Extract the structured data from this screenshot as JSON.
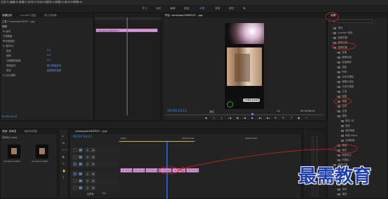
{
  "menu": [
    "文件(F)",
    "编辑(E)",
    "剪辑(C)",
    "序列(S)",
    "标记(M)",
    "图形(G)",
    "视图(V)",
    "窗口(W)",
    "帮助(H)"
  ],
  "workspaces": [
    {
      "label": "学习",
      "active": false
    },
    {
      "label": "组件",
      "active": false
    },
    {
      "label": "编辑",
      "active": false
    },
    {
      "label": "颜色",
      "active": false
    },
    {
      "label": "效果",
      "active": true
    },
    {
      "label": "音频",
      "active": false
    },
    {
      "label": "图形",
      "active": false
    },
    {
      "label": "库",
      "active": false
    }
  ],
  "effect_controls": {
    "tabs": [
      "效果控件",
      "Lumetri 范围",
      "源:(无剪辑)",
      "音频剪辑混合器:"
    ],
    "master_label": "主要 * mmexport1609....jpg",
    "sequence_label": "序列 * mmexport1609....jpg",
    "clip_label": "mmexport1609537...",
    "video_heading": "视频",
    "rows": [
      {
        "label": "fx 运动",
        "value": "",
        "indent": 0
      },
      {
        "label": "不透明度",
        "value": "",
        "indent": 0
      },
      {
        "label": "时间重映射",
        "value": "",
        "indent": 0
      },
      {
        "label": "fx 基本3D",
        "value": "",
        "indent": 0
      },
      {
        "label": "旋转",
        "value": "0.0",
        "indent": 1
      },
      {
        "label": "倾斜",
        "value": "0.0",
        "indent": 1
      },
      {
        "label": "与图像的距离",
        "value": "0.0",
        "indent": 1
      },
      {
        "label": "镜面高光",
        "value": "显示镜面高光",
        "indent": 1
      },
      {
        "label": "预览",
        "value": "绘制预览线框",
        "indent": 1
      },
      {
        "label": "fx 交叉溶解",
        "value": "",
        "indent": 0
      }
    ],
    "timecode": "00:00:03:11"
  },
  "program": {
    "title": "节目: mmexport1609537....jpg",
    "timecode": "00:00:03:11",
    "fit": "适合",
    "ratio": "1/2",
    "duration": "00:00:06:00",
    "caption_text": "分享教程 更多资源"
  },
  "project": {
    "tabs": [
      "项目: 未命名",
      "媒体浏览器"
    ],
    "project_name": "未命名.prproj",
    "items": [
      {
        "name": "mmexport1609...",
        "duration": "5:00"
      },
      {
        "name": "mmexport1609...",
        "duration": "5:00"
      }
    ]
  },
  "timeline": {
    "tab": "mmexport1609537....jpg",
    "timecode": "00:00:03:11",
    "ruler_marks": [
      "00:00",
      "00:00:05:00",
      "00:00:10:00",
      "00:00:15:00"
    ],
    "tracks": [
      {
        "id": "V3"
      },
      {
        "id": "V2"
      },
      {
        "id": "V1"
      },
      {
        "id": "A1"
      },
      {
        "id": "A2"
      },
      {
        "id": "A3"
      }
    ],
    "master_label": "主声道",
    "master_value": "0.0",
    "clips": [
      {
        "label": "fx mm..jpg"
      },
      {
        "label": "fx mm..jpg"
      },
      {
        "label": "fx mm..jpg"
      },
      {
        "label": "fx mmexport..."
      },
      {
        "label": "fx mm..jpg"
      },
      {
        "label": "fx mm..jpg"
      }
    ]
  },
  "effects_panel": {
    "title": "效果",
    "tree": [
      {
        "label": "预设",
        "depth": 0
      },
      {
        "label": "Lumetri 预设",
        "depth": 0
      },
      {
        "label": "音频效果",
        "depth": 0
      },
      {
        "label": "音频过渡",
        "depth": 0
      },
      {
        "label": "视频效果",
        "depth": 0
      },
      {
        "label": "变换",
        "depth": 1
      },
      {
        "label": "图像控制",
        "depth": 1
      },
      {
        "label": "实用程序",
        "depth": 1
      },
      {
        "label": "扭曲",
        "depth": 1
      },
      {
        "label": "时间",
        "depth": 1
      },
      {
        "label": "杂色与颗粒",
        "depth": 1
      },
      {
        "label": "模糊与锐化",
        "depth": 1
      },
      {
        "label": "沉浸式视频",
        "depth": 1
      },
      {
        "label": "生成",
        "depth": 1
      },
      {
        "label": "视频",
        "depth": 1
      },
      {
        "label": "调整",
        "depth": 1
      },
      {
        "label": "过时",
        "depth": 1
      },
      {
        "label": "过渡",
        "depth": 1
      },
      {
        "label": "透视",
        "depth": 1
      },
      {
        "label": "基本 3D",
        "depth": 2
      },
      {
        "label": "投影",
        "depth": 2
      },
      {
        "label": "放射阴影",
        "depth": 2
      },
      {
        "label": "斜面 Alpha",
        "depth": 2
      },
      {
        "label": "边缘斜面",
        "depth": 2
      },
      {
        "label": "通道",
        "depth": 1
      },
      {
        "label": "键控",
        "depth": 1
      },
      {
        "label": "颜色校正",
        "depth": 1
      },
      {
        "label": "风格化",
        "depth": 1
      },
      {
        "label": "视频过渡",
        "depth": 0
      },
      {
        "label": "3D 运动",
        "depth": 1
      },
      {
        "label": "划像",
        "depth": 1
      },
      {
        "label": "擦除",
        "depth": 1
      },
      {
        "label": "溶解",
        "depth": 1
      },
      {
        "label": "滑动",
        "depth": 1
      },
      {
        "label": "缩放",
        "depth": 1
      }
    ]
  },
  "watermark": "最需教育",
  "colors": {
    "accent": "#3c8cf0",
    "clip": "#d69ad4",
    "annotation": "#d02020",
    "timecode": "#3c8cf0"
  }
}
